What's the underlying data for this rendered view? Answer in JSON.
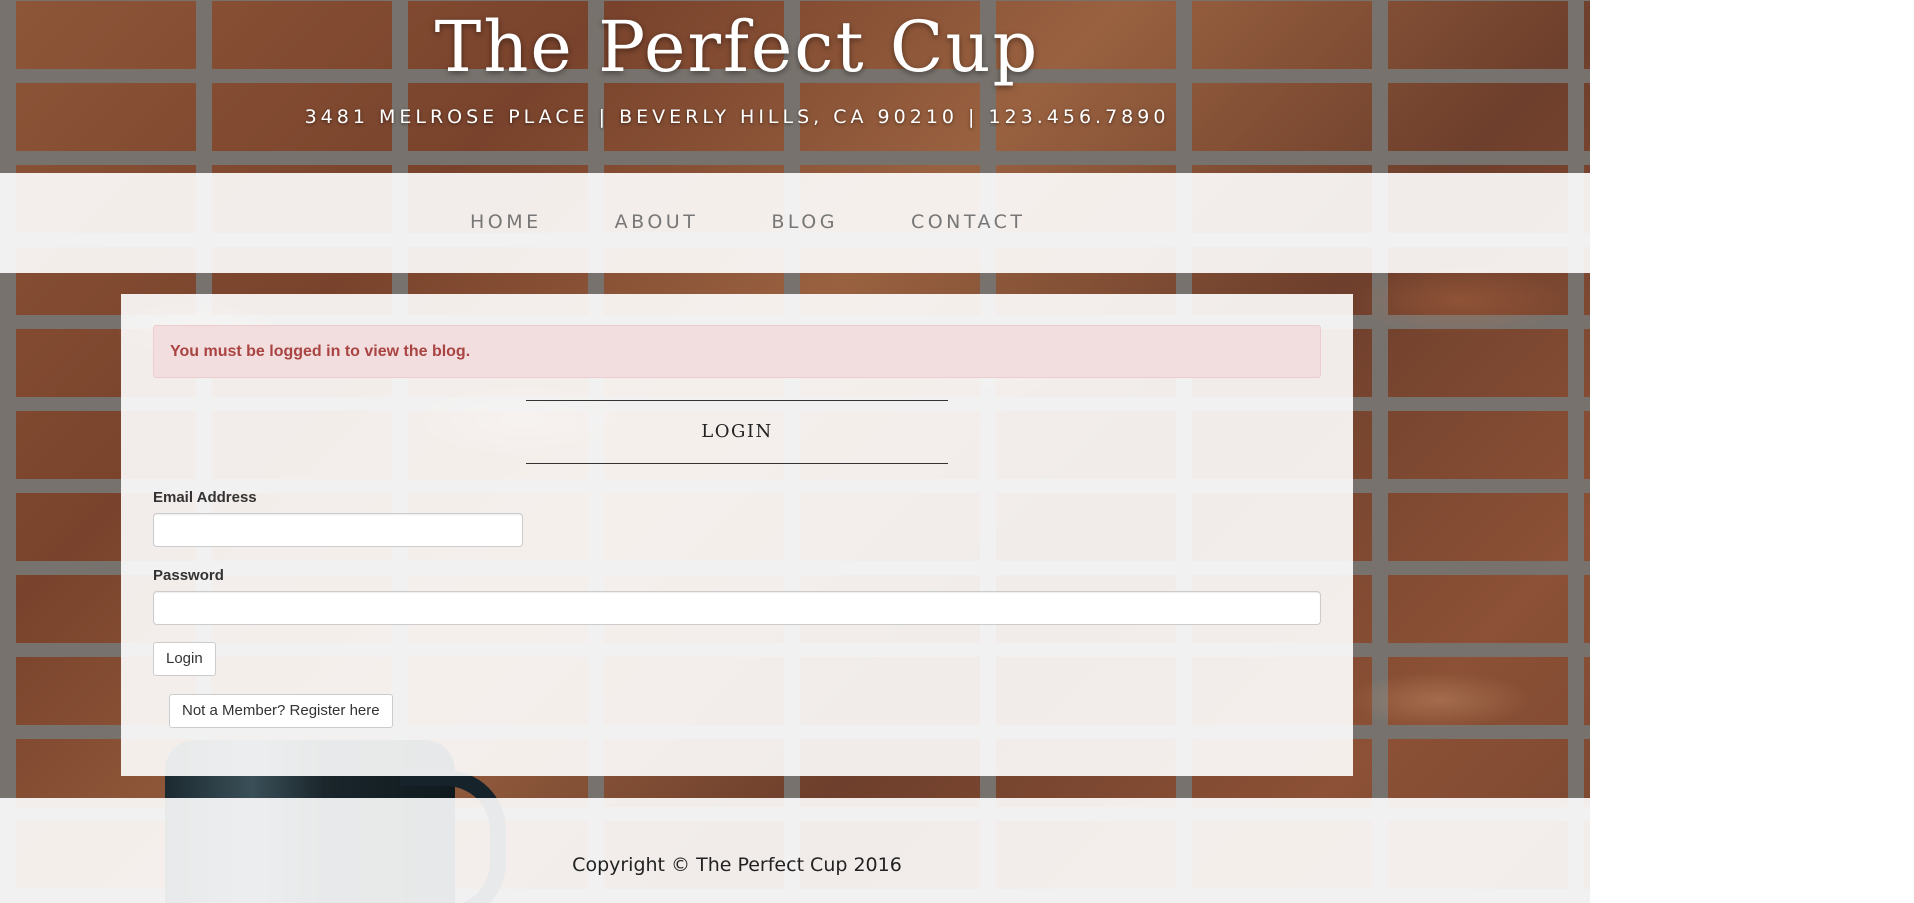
{
  "header": {
    "brand": "The Perfect Cup",
    "address": "3481 MELROSE PLACE | BEVERLY HILLS, CA 90210 | 123.456.7890"
  },
  "nav": {
    "items": [
      {
        "label": "HOME"
      },
      {
        "label": "ABOUT"
      },
      {
        "label": "BLOG"
      },
      {
        "label": "CONTACT"
      }
    ]
  },
  "alert": {
    "message": "You must be logged in to view the blog.",
    "color": "#a94442",
    "background": "#f2dede"
  },
  "login": {
    "title": "LOGIN",
    "email_label": "Email Address",
    "email_value": "",
    "password_label": "Password",
    "password_value": "",
    "login_button": "Login",
    "register_button": "Not a Member? Register here"
  },
  "footer": {
    "copyright": "Copyright © The Perfect Cup 2016"
  }
}
